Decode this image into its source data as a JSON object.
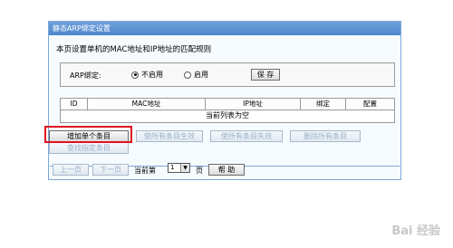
{
  "panel": {
    "title": "静态ARP绑定设置",
    "description": "本页设置单机的MAC地址和IP地址的匹配规则"
  },
  "arp": {
    "label": "ARP绑定:",
    "options": [
      "不启用",
      "启用"
    ],
    "selected": "不启用",
    "save_label": "保 存"
  },
  "table": {
    "headers": [
      "ID",
      "MAC地址",
      "IP地址",
      "绑定",
      "配置"
    ],
    "empty_text": "当前列表为空"
  },
  "actions": {
    "add_single": "增加单个条目",
    "enable_all": "使所有条目生效",
    "disable_all": "使所有条目失效",
    "delete_all": "删除所有条目",
    "find": "查找指定条目"
  },
  "pager": {
    "prev": "上一页",
    "next": "下一页",
    "current_prefix": "当前第",
    "page_value": "1",
    "page_suffix": "页",
    "help": "帮 助"
  },
  "watermark": "Bai 经验",
  "colors": {
    "title_bar": "#5b8fd2",
    "highlight": "#e0141e"
  }
}
